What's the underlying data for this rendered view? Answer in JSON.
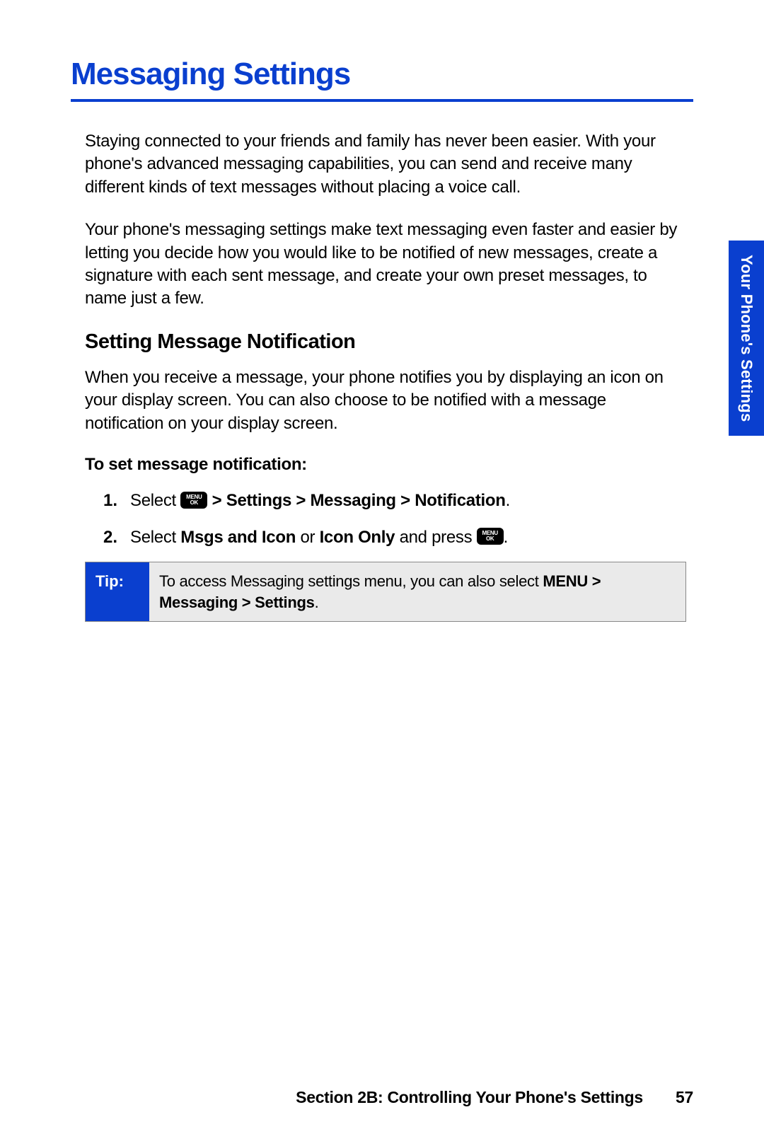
{
  "title": "Messaging Settings",
  "intro": [
    "Staying connected to your friends and family has never been easier. With your phone's advanced messaging capabilities, you can send and receive many different kinds of text messages without placing a voice call.",
    "Your phone's messaging settings make text messaging even faster and easier by letting you decide how you would like to be notified of new messages, create a signature with each sent message, and create your own preset messages, to name just a few."
  ],
  "section": {
    "heading": "Setting Message Notification",
    "para": "When you receive a message, your phone notifies you by displaying an icon on your display screen. You can also choose to be notified with a message notification on your display screen.",
    "task_heading": "To set message notification:",
    "steps": [
      {
        "num": "1.",
        "pre": "Select ",
        "path": " > Settings > Messaging > Notification",
        "end": "."
      },
      {
        "num": "2.",
        "pre": "Select ",
        "b1": "Msgs and Icon",
        "mid1": " or ",
        "b2": "Icon Only",
        "mid2": " and press ",
        "end": "."
      }
    ]
  },
  "tip": {
    "label": "Tip:",
    "text": "To access Messaging settings menu, you can also select ",
    "bold1": "MENU > Messaging > Settings",
    "end": "."
  },
  "sidetab": "Your Phone's Settings",
  "footer": {
    "section": "Section 2B: Controlling Your Phone's Settings",
    "page": "57"
  },
  "menu_key": {
    "top": "MENU",
    "bottom": "OK"
  }
}
